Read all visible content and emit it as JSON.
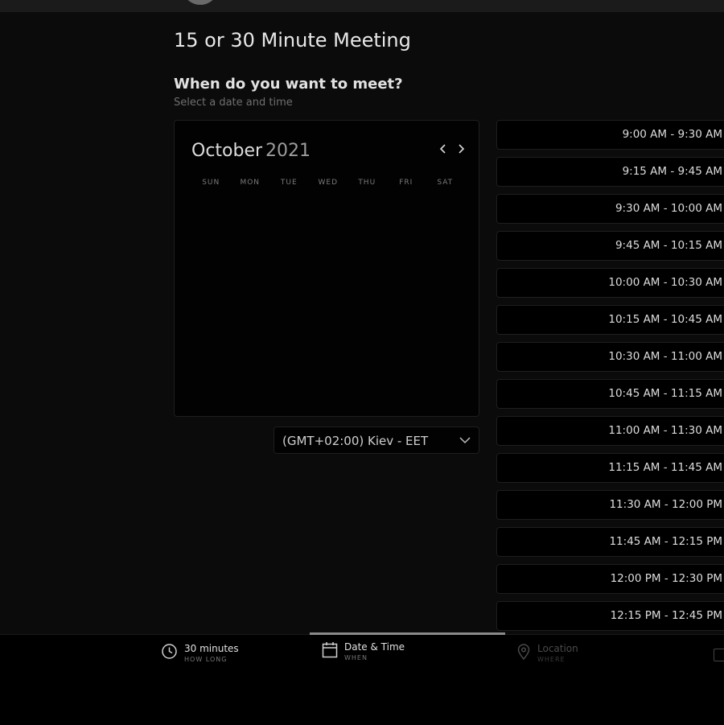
{
  "meeting": {
    "title": "15 or 30 Minute Meeting",
    "section_title": "When do you want to meet?",
    "section_subtitle": "Select a date and time"
  },
  "calendar": {
    "month": "October",
    "year": "2021",
    "weekdays": [
      "SUN",
      "MON",
      "TUE",
      "WED",
      "THU",
      "FRI",
      "SAT"
    ],
    "prev_icon": "chevron-left-icon",
    "next_icon": "chevron-right-icon"
  },
  "timezone": {
    "selected": "(GMT+02:00) Kiev - EET",
    "icon": "chevron-down-icon"
  },
  "time_slots": [
    "9:00 AM - 9:30 AM",
    "9:15 AM - 9:45 AM",
    "9:30 AM - 10:00 AM",
    "9:45 AM - 10:15 AM",
    "10:00 AM - 10:30 AM",
    "10:15 AM - 10:45 AM",
    "10:30 AM - 11:00 AM",
    "10:45 AM - 11:15 AM",
    "11:00 AM - 11:30 AM",
    "11:15 AM - 11:45 AM",
    "11:30 AM - 12:00 PM",
    "11:45 AM - 12:15 PM",
    "12:00 PM - 12:30 PM",
    "12:15 PM - 12:45 PM"
  ],
  "steps": {
    "duration": {
      "title": "30 minutes",
      "sub": "HOW LONG",
      "icon": "clock-icon"
    },
    "datetime": {
      "title": "Date & Time",
      "sub": "WHEN",
      "icon": "calendar-icon"
    },
    "location": {
      "title": "Location",
      "sub": "WHERE",
      "icon": "location-pin-icon"
    }
  },
  "colors": {
    "background": "#0b0b0b",
    "panel": "#020202",
    "border": "#1e1e1e",
    "active_indicator": "#8a8a8a"
  }
}
